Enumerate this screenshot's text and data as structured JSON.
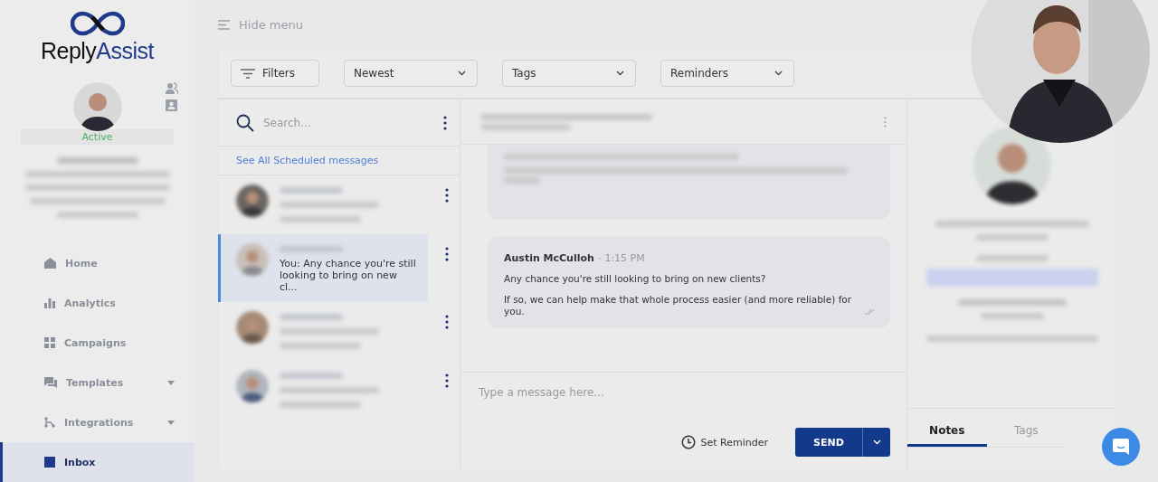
{
  "logo": {
    "first": "Reply",
    "second": "Assist"
  },
  "profile": {
    "status": "Active"
  },
  "nav": [
    {
      "label": "Home",
      "submenu": false,
      "selected": false
    },
    {
      "label": "Analytics",
      "submenu": false,
      "selected": false
    },
    {
      "label": "Campaigns",
      "submenu": false,
      "selected": false
    },
    {
      "label": "Templates",
      "submenu": true,
      "selected": false
    },
    {
      "label": "Integrations",
      "submenu": true,
      "selected": false
    },
    {
      "label": "Inbox",
      "submenu": false,
      "selected": true
    }
  ],
  "header": {
    "toggle": "Hide menu"
  },
  "toolbar": {
    "filters": "Filters",
    "dropdowns": [
      "Newest",
      "Tags",
      "Reminders"
    ]
  },
  "conversations": {
    "search": {
      "placeholder": "Search..."
    },
    "scheduled_link": "See All Scheduled messages",
    "items": [
      {
        "selected": false
      },
      {
        "selected": true,
        "preview": "You: Any chance you're still looking to bring on new cl..."
      },
      {
        "selected": false
      },
      {
        "selected": false
      }
    ]
  },
  "chat": {
    "message": {
      "sender": "Austin McCulloh",
      "separator": "·",
      "time": "1:15 PM",
      "paragraphs": [
        "Any chance you're still looking to bring on new clients?",
        "If so, we can help make that whole process easier (and more reliable) for you."
      ]
    },
    "composer": {
      "placeholder": "Type a message here..."
    },
    "reminder": "Set Reminder",
    "send": "SEND"
  },
  "details": {
    "tabs": [
      {
        "label": "Notes",
        "selected": true
      },
      {
        "label": "Tags",
        "selected": false
      }
    ]
  }
}
